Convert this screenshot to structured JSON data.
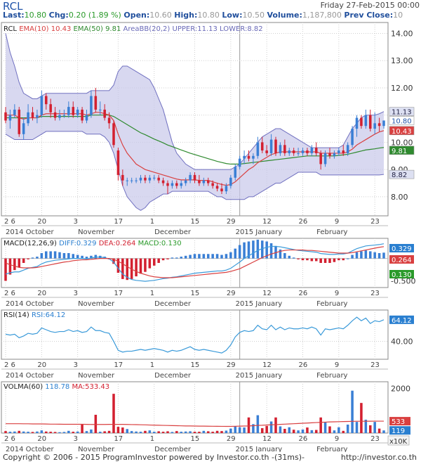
{
  "header": {
    "symbol": "RCL",
    "datetime": "Friday 27-Feb-2015 00:00",
    "last_label": "Last:",
    "last": "10.80",
    "chg_label": "Chg:",
    "chg": "0.20 (1.89 %)",
    "open_label": "Open:",
    "open": "10.60",
    "high_label": "High:",
    "high": "10.80",
    "low_label": "Low:",
    "low": "10.50",
    "volume_label": "Volume:",
    "volume": "1,187,800",
    "prevclose_label": "Prev Close:",
    "prevclose": "10"
  },
  "panels": {
    "price": {
      "legend": {
        "sym": "RCL",
        "ema10": "EMA(10)",
        "ema10_val": "10.43",
        "ema50": "EMA(50)",
        "ema50_val": "9.81",
        "bb": "AreaBB(20,2)",
        "upper": "UPPER:11.13",
        "lower": "LOWER:8.82"
      },
      "y_ticks": [
        "14.00",
        "13.00",
        "12.00",
        "11.00",
        "10.00",
        "9.00",
        "8.00"
      ],
      "badges": {
        "upper": "11.13",
        "last": "10.80",
        "ema10": "10.43",
        "ema50": "9.81",
        "lower": "8.82"
      }
    },
    "macd": {
      "legend": {
        "name": "MACD(12,26,9)",
        "diff": "DIFF:0.329",
        "dea": "DEA:0.264",
        "macd": "MACD:0.130"
      },
      "y_ticks": [
        "-0.500"
      ],
      "badges": {
        "diff": "0.329",
        "dea": "0.264",
        "macd": "0.130"
      }
    },
    "rsi": {
      "legend": {
        "name": "RSI(14)",
        "rsi": "RSI:64.12"
      },
      "y_ticks": [
        "40.00"
      ],
      "badges": {
        "rsi": "64.12"
      }
    },
    "vol": {
      "legend": {
        "name": "VOLMA(60)",
        "volma": "118.78",
        "ma": "MA:533.43"
      },
      "y_ticks": [
        "2000"
      ],
      "badges": {
        "ma": "533",
        "volma": "119",
        "scale": "x10K"
      }
    }
  },
  "x_axis": {
    "day_ticks": [
      "2 6",
      "20",
      "3",
      "17",
      "1",
      "15",
      "29",
      "12",
      "26",
      "9",
      "23"
    ],
    "month_labels": [
      "2014 October",
      "November",
      "December",
      "2015 January",
      "February"
    ]
  },
  "footer": {
    "left": "Copyright © 2006 - 2015 ProgramInvestor powered by Investor.co.th -(31ms)-",
    "right": "http://investor.co.th"
  },
  "colors": {
    "up": "#3a7fd5",
    "down": "#d32030",
    "ema10": "#d94040",
    "ema50": "#2f8a2f",
    "bb_fill": "#c8c8ea",
    "bb_line": "#7070c0",
    "grid": "#cfcfcf",
    "macd_line": "#3a9ad9"
  },
  "chart_data": {
    "type": "line",
    "candles": [
      [
        11.1,
        11.3,
        10.7,
        10.8
      ],
      [
        10.8,
        11.2,
        10.5,
        11.0
      ],
      [
        11.0,
        11.4,
        10.9,
        11.2
      ],
      [
        11.2,
        11.3,
        10.2,
        10.3
      ],
      [
        10.3,
        10.9,
        10.1,
        10.7
      ],
      [
        10.7,
        11.4,
        10.6,
        11.1
      ],
      [
        11.1,
        11.3,
        10.8,
        10.9
      ],
      [
        10.9,
        11.2,
        10.7,
        11.0
      ],
      [
        11.0,
        11.9,
        10.9,
        11.7
      ],
      [
        11.7,
        11.8,
        11.2,
        11.4
      ],
      [
        11.4,
        11.6,
        10.9,
        11.1
      ],
      [
        11.1,
        11.3,
        10.8,
        10.9
      ],
      [
        10.9,
        11.2,
        10.8,
        11.0
      ],
      [
        11.0,
        11.2,
        10.9,
        11.0
      ],
      [
        11.0,
        11.5,
        10.9,
        11.3
      ],
      [
        11.3,
        11.5,
        10.9,
        11.0
      ],
      [
        11.0,
        11.3,
        10.9,
        11.2
      ],
      [
        11.2,
        11.3,
        10.7,
        10.8
      ],
      [
        10.8,
        11.2,
        10.7,
        11.0
      ],
      [
        11.0,
        11.9,
        10.9,
        11.7
      ],
      [
        11.7,
        12.0,
        11.1,
        11.2
      ],
      [
        11.2,
        11.5,
        11.0,
        11.2
      ],
      [
        11.2,
        11.4,
        10.8,
        10.9
      ],
      [
        10.9,
        11.1,
        10.5,
        10.7
      ],
      [
        10.7,
        10.8,
        9.8,
        9.9
      ],
      [
        9.7,
        9.8,
        8.6,
        8.8
      ],
      [
        8.8,
        9.0,
        8.4,
        8.6
      ],
      [
        8.6,
        8.7,
        8.4,
        8.6
      ],
      [
        8.6,
        8.7,
        8.5,
        8.6
      ],
      [
        8.6,
        8.7,
        8.5,
        8.6
      ],
      [
        8.6,
        8.8,
        8.5,
        8.7
      ],
      [
        8.7,
        8.8,
        8.5,
        8.6
      ],
      [
        8.6,
        8.8,
        8.5,
        8.7
      ],
      [
        8.7,
        8.8,
        8.6,
        8.7
      ],
      [
        8.7,
        8.8,
        8.5,
        8.6
      ],
      [
        8.6,
        8.7,
        8.4,
        8.5
      ],
      [
        8.5,
        8.6,
        8.1,
        8.4
      ],
      [
        8.4,
        8.6,
        8.3,
        8.5
      ],
      [
        8.5,
        8.6,
        8.3,
        8.4
      ],
      [
        8.4,
        8.6,
        8.3,
        8.5
      ],
      [
        8.5,
        8.7,
        8.4,
        8.6
      ],
      [
        8.6,
        8.9,
        8.5,
        8.8
      ],
      [
        8.8,
        8.9,
        8.5,
        8.6
      ],
      [
        8.6,
        8.8,
        8.4,
        8.5
      ],
      [
        8.5,
        8.7,
        8.4,
        8.6
      ],
      [
        8.6,
        8.7,
        8.4,
        8.5
      ],
      [
        8.5,
        8.6,
        8.3,
        8.4
      ],
      [
        8.4,
        8.5,
        8.2,
        8.3
      ],
      [
        8.3,
        8.5,
        8.1,
        8.2
      ],
      [
        8.2,
        8.5,
        8.1,
        8.4
      ],
      [
        8.4,
        8.8,
        8.3,
        8.7
      ],
      [
        8.7,
        9.2,
        8.6,
        9.1
      ],
      [
        9.1,
        9.5,
        9.0,
        9.4
      ],
      [
        9.4,
        9.7,
        9.2,
        9.5
      ],
      [
        9.5,
        9.7,
        9.3,
        9.4
      ],
      [
        9.4,
        9.6,
        9.2,
        9.5
      ],
      [
        9.5,
        10.2,
        9.4,
        10.0
      ],
      [
        10.0,
        10.2,
        9.6,
        9.7
      ],
      [
        9.7,
        9.9,
        9.5,
        9.6
      ],
      [
        9.6,
        10.3,
        9.5,
        10.1
      ],
      [
        10.1,
        10.2,
        9.5,
        9.6
      ],
      [
        9.6,
        10.0,
        9.5,
        9.9
      ],
      [
        9.9,
        10.1,
        9.5,
        9.6
      ],
      [
        9.6,
        9.8,
        9.5,
        9.7
      ],
      [
        9.7,
        9.8,
        9.5,
        9.6
      ],
      [
        9.6,
        9.8,
        9.5,
        9.6
      ],
      [
        9.6,
        9.8,
        9.5,
        9.7
      ],
      [
        9.7,
        9.8,
        9.5,
        9.6
      ],
      [
        9.6,
        9.9,
        9.5,
        9.8
      ],
      [
        9.8,
        10.0,
        9.5,
        9.6
      ],
      [
        9.6,
        9.7,
        9.0,
        9.2
      ],
      [
        9.2,
        9.7,
        9.1,
        9.6
      ],
      [
        9.6,
        9.8,
        9.4,
        9.5
      ],
      [
        9.5,
        9.7,
        9.4,
        9.6
      ],
      [
        9.6,
        9.8,
        9.5,
        9.7
      ],
      [
        9.7,
        9.9,
        9.5,
        9.6
      ],
      [
        9.6,
        10.0,
        9.5,
        9.9
      ],
      [
        9.9,
        10.6,
        9.8,
        10.5
      ],
      [
        10.5,
        11.0,
        10.2,
        10.9
      ],
      [
        10.9,
        11.0,
        10.5,
        10.6
      ],
      [
        10.6,
        11.2,
        10.5,
        11.0
      ],
      [
        11.0,
        11.2,
        10.4,
        10.5
      ],
      [
        10.5,
        11.1,
        10.3,
        10.7
      ],
      [
        10.7,
        10.9,
        10.4,
        10.6
      ],
      [
        10.6,
        10.8,
        10.5,
        10.8
      ]
    ],
    "ema10": [
      11.0,
      11.0,
      11.0,
      10.9,
      10.85,
      10.9,
      10.9,
      10.9,
      11.0,
      11.05,
      11.05,
      11.05,
      11.05,
      11.05,
      11.05,
      11.05,
      11.05,
      11.05,
      11.0,
      11.05,
      11.1,
      11.1,
      11.05,
      11.0,
      10.8,
      10.3,
      9.9,
      9.6,
      9.4,
      9.2,
      9.1,
      9.0,
      8.95,
      8.9,
      8.85,
      8.8,
      8.75,
      8.7,
      8.65,
      8.62,
      8.62,
      8.62,
      8.62,
      8.6,
      8.6,
      8.6,
      8.55,
      8.5,
      8.45,
      8.42,
      8.45,
      8.55,
      8.7,
      8.85,
      9.0,
      9.1,
      9.25,
      9.35,
      9.45,
      9.55,
      9.6,
      9.65,
      9.65,
      9.65,
      9.65,
      9.65,
      9.65,
      9.65,
      9.65,
      9.65,
      9.6,
      9.6,
      9.6,
      9.6,
      9.6,
      9.6,
      9.65,
      9.75,
      9.9,
      10.0,
      10.1,
      10.2,
      10.3,
      10.38,
      10.43
    ],
    "ema50": [
      10.9,
      10.9,
      10.9,
      10.9,
      10.9,
      10.9,
      10.9,
      10.9,
      10.95,
      10.95,
      10.95,
      10.95,
      10.95,
      10.95,
      10.95,
      10.95,
      10.95,
      10.95,
      10.95,
      11.0,
      11.0,
      11.0,
      11.0,
      11.0,
      10.95,
      10.85,
      10.75,
      10.65,
      10.55,
      10.45,
      10.35,
      10.28,
      10.2,
      10.12,
      10.05,
      9.98,
      9.9,
      9.84,
      9.78,
      9.72,
      9.66,
      9.6,
      9.55,
      9.5,
      9.45,
      9.4,
      9.35,
      9.3,
      9.26,
      9.22,
      9.2,
      9.2,
      9.2,
      9.22,
      9.24,
      9.26,
      9.28,
      9.3,
      9.32,
      9.34,
      9.36,
      9.38,
      9.4,
      9.42,
      9.44,
      9.46,
      9.48,
      9.5,
      9.5,
      9.5,
      9.5,
      9.5,
      9.5,
      9.5,
      9.52,
      9.54,
      9.56,
      9.6,
      9.64,
      9.68,
      9.72,
      9.74,
      9.76,
      9.79,
      9.81
    ],
    "bb_upper": [
      14.0,
      13.3,
      12.8,
      12.2,
      11.8,
      11.7,
      11.6,
      11.6,
      11.7,
      11.8,
      11.8,
      11.8,
      11.8,
      11.8,
      11.8,
      11.8,
      11.8,
      11.8,
      11.8,
      11.9,
      11.9,
      11.9,
      11.9,
      11.9,
      12.1,
      12.6,
      12.8,
      12.8,
      12.7,
      12.6,
      12.5,
      12.4,
      12.3,
      12.0,
      11.6,
      11.2,
      10.6,
      10.0,
      9.6,
      9.4,
      9.2,
      9.1,
      9.0,
      9.0,
      9.0,
      9.0,
      9.0,
      9.0,
      9.0,
      9.0,
      9.0,
      9.1,
      9.2,
      9.4,
      9.6,
      9.8,
      10.0,
      10.2,
      10.3,
      10.4,
      10.5,
      10.5,
      10.4,
      10.3,
      10.2,
      10.1,
      10.0,
      9.9,
      9.8,
      9.8,
      9.8,
      9.8,
      9.8,
      9.8,
      9.8,
      9.9,
      10.2,
      10.5,
      10.7,
      10.9,
      11.0,
      11.0,
      11.0,
      11.05,
      11.13
    ],
    "bb_lower": [
      10.3,
      10.2,
      10.1,
      10.1,
      10.1,
      10.1,
      10.1,
      10.2,
      10.3,
      10.4,
      10.4,
      10.4,
      10.4,
      10.4,
      10.4,
      10.4,
      10.4,
      10.4,
      10.3,
      10.3,
      10.3,
      10.3,
      10.2,
      10.0,
      9.6,
      9.0,
      8.4,
      8.0,
      7.8,
      7.6,
      7.5,
      7.6,
      7.8,
      7.9,
      8.0,
      8.1,
      8.1,
      8.2,
      8.2,
      8.2,
      8.2,
      8.2,
      8.2,
      8.2,
      8.2,
      8.2,
      8.1,
      8.0,
      8.0,
      7.9,
      7.9,
      7.9,
      7.9,
      7.9,
      8.0,
      8.0,
      8.1,
      8.2,
      8.3,
      8.4,
      8.5,
      8.5,
      8.6,
      8.7,
      8.8,
      8.9,
      8.9,
      8.9,
      8.9,
      8.9,
      8.8,
      8.8,
      8.8,
      8.8,
      8.8,
      8.8,
      8.8,
      8.8,
      8.8,
      8.8,
      8.8,
      8.8,
      8.8,
      8.8,
      8.82
    ],
    "macd_diff": [
      -0.35,
      -0.32,
      -0.3,
      -0.3,
      -0.26,
      -0.22,
      -0.2,
      -0.18,
      -0.12,
      -0.08,
      -0.06,
      -0.04,
      -0.03,
      -0.02,
      -0.01,
      0.0,
      0.0,
      0.0,
      -0.01,
      0.01,
      0.03,
      0.03,
      0.02,
      -0.01,
      -0.08,
      -0.22,
      -0.35,
      -0.42,
      -0.47,
      -0.49,
      -0.5,
      -0.51,
      -0.5,
      -0.49,
      -0.47,
      -0.45,
      -0.44,
      -0.42,
      -0.41,
      -0.39,
      -0.37,
      -0.35,
      -0.33,
      -0.32,
      -0.31,
      -0.3,
      -0.29,
      -0.28,
      -0.28,
      -0.26,
      -0.22,
      -0.15,
      -0.08,
      0.0,
      0.06,
      0.12,
      0.18,
      0.22,
      0.25,
      0.27,
      0.27,
      0.26,
      0.24,
      0.22,
      0.2,
      0.18,
      0.17,
      0.16,
      0.15,
      0.14,
      0.11,
      0.1,
      0.09,
      0.09,
      0.1,
      0.1,
      0.12,
      0.17,
      0.22,
      0.25,
      0.28,
      0.29,
      0.3,
      0.31,
      0.329
    ],
    "macd_dea": [
      -0.1,
      -0.14,
      -0.17,
      -0.2,
      -0.21,
      -0.21,
      -0.21,
      -0.2,
      -0.18,
      -0.16,
      -0.14,
      -0.12,
      -0.1,
      -0.08,
      -0.07,
      -0.05,
      -0.04,
      -0.03,
      -0.03,
      -0.02,
      -0.01,
      0.0,
      0.0,
      0.0,
      -0.02,
      -0.06,
      -0.12,
      -0.18,
      -0.24,
      -0.29,
      -0.33,
      -0.36,
      -0.39,
      -0.41,
      -0.42,
      -0.43,
      -0.43,
      -0.43,
      -0.42,
      -0.41,
      -0.4,
      -0.39,
      -0.38,
      -0.37,
      -0.36,
      -0.35,
      -0.34,
      -0.33,
      -0.32,
      -0.31,
      -0.29,
      -0.26,
      -0.23,
      -0.18,
      -0.13,
      -0.08,
      -0.03,
      0.02,
      0.06,
      0.1,
      0.13,
      0.16,
      0.18,
      0.19,
      0.19,
      0.19,
      0.19,
      0.18,
      0.18,
      0.17,
      0.16,
      0.15,
      0.14,
      0.13,
      0.12,
      0.12,
      0.12,
      0.13,
      0.15,
      0.17,
      0.19,
      0.21,
      0.23,
      0.25,
      0.264
    ],
    "rsi": [
      48,
      47,
      48,
      44,
      46,
      49,
      48,
      49,
      55,
      53,
      51,
      50,
      51,
      51,
      53,
      51,
      52,
      50,
      51,
      56,
      52,
      52,
      50,
      49,
      40,
      30,
      28,
      29,
      29,
      30,
      31,
      30,
      31,
      32,
      31,
      30,
      28,
      30,
      29,
      30,
      32,
      34,
      31,
      30,
      31,
      30,
      29,
      28,
      27,
      30,
      36,
      45,
      50,
      52,
      51,
      52,
      58,
      54,
      53,
      58,
      53,
      56,
      53,
      55,
      54,
      54,
      55,
      54,
      56,
      54,
      47,
      54,
      53,
      54,
      55,
      54,
      58,
      63,
      67,
      63,
      66,
      60,
      63,
      62,
      64.12
    ],
    "volume": [
      90,
      60,
      70,
      100,
      70,
      60,
      50,
      70,
      120,
      70,
      60,
      50,
      40,
      50,
      100,
      60,
      70,
      400,
      90,
      160,
      820,
      60,
      80,
      100,
      1760,
      280,
      250,
      180,
      90,
      70,
      60,
      100,
      120,
      60,
      80,
      60,
      80,
      50,
      90,
      60,
      70,
      80,
      60,
      60,
      100,
      80,
      60,
      100,
      90,
      110,
      200,
      300,
      260,
      250,
      700,
      400,
      800,
      220,
      320,
      520,
      700,
      300,
      190,
      260,
      150,
      120,
      160,
      250,
      130,
      140,
      700,
      480,
      300,
      120,
      260,
      100,
      380,
      1900,
      500,
      1350,
      600,
      350,
      500,
      200,
      119
    ],
    "volume_ma": [
      420,
      420,
      420,
      420,
      415,
      415,
      410,
      410,
      410,
      405,
      400,
      400,
      398,
      395,
      395,
      395,
      395,
      395,
      390,
      385,
      385,
      385,
      385,
      390,
      390,
      390,
      390,
      385,
      380,
      378,
      372,
      368,
      360,
      355,
      350,
      345,
      340,
      335,
      330,
      325,
      320,
      318,
      315,
      312,
      310,
      308,
      306,
      304,
      302,
      300,
      300,
      305,
      310,
      315,
      320,
      330,
      345,
      350,
      360,
      370,
      380,
      390,
      400,
      410,
      420,
      430,
      440,
      450,
      460,
      470,
      480,
      490,
      500,
      505,
      510,
      515,
      520,
      525,
      530,
      530,
      530,
      532,
      533,
      533,
      533.43
    ],
    "ylim_price": [
      7.3,
      14.4
    ],
    "ylim_macd": [
      -0.65,
      0.45
    ],
    "ylim_rsi": [
      20,
      75
    ],
    "ylim_vol": [
      0,
      2300
    ]
  }
}
